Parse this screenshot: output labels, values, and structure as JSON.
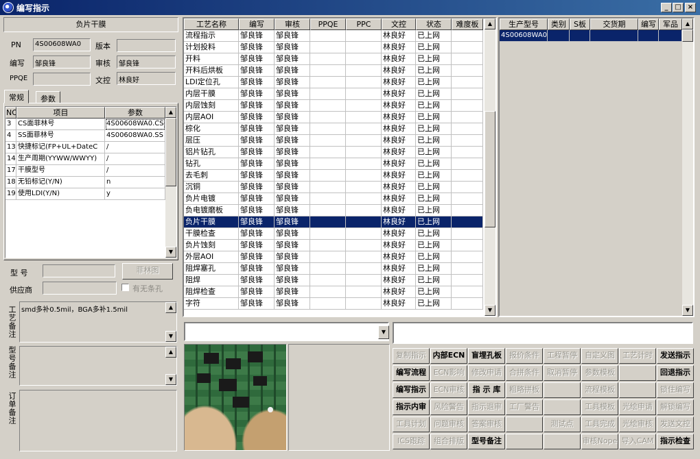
{
  "window": {
    "title": "编写指示",
    "min": "_",
    "max": "□",
    "close": "×"
  },
  "left": {
    "process_name": "负片干膜",
    "pn_label": "PN",
    "pn_value": "4S00608WA0",
    "version_label": "版本",
    "version_value": "",
    "writer_label": "编写",
    "writer_value": "邹良锋",
    "reviewer_label": "审核",
    "reviewer_value": "邹良锋",
    "ppqe_label": "PPQE",
    "ppqe_value": "",
    "doc_ctrl_label": "文控",
    "doc_ctrl_value": "林良好",
    "tabs": [
      "常规",
      "参数"
    ],
    "param_headers": [
      "NO",
      "项目",
      "参数"
    ],
    "params": [
      {
        "no": "3",
        "item": "CS面菲林号",
        "value": "4S00608WA0.CS"
      },
      {
        "no": "4",
        "item": "SS面菲林号",
        "value": "4S00608WA0.SS"
      },
      {
        "no": "13",
        "item": "快捷标记(FP+UL+DateC",
        "value": "/"
      },
      {
        "no": "14",
        "item": "生产周期(YYWW/WWYY)",
        "value": "/"
      },
      {
        "no": "17",
        "item": "干膜型号",
        "value": "/"
      },
      {
        "no": "18",
        "item": "无铅标记(Y/N)",
        "value": "n"
      },
      {
        "no": "19",
        "item": "使用LDI(Y/N)",
        "value": "y"
      }
    ],
    "model_label": "型  号",
    "model_value": "",
    "film_button": "菲林图",
    "supplier_label": "供应商",
    "supplier_value": "",
    "barcode_label": "有无条孔",
    "process_note_label": "工艺备注",
    "process_note": "smd多补0.5mil，BGA多补1.5mil",
    "model_note_label": "型号备注",
    "model_note": "",
    "order_note_label": "订单备注",
    "order_note": ""
  },
  "process_table": {
    "headers": [
      "工艺名称",
      "编写",
      "审核",
      "PPQE",
      "PPC",
      "文控",
      "状态",
      "难度板"
    ],
    "rows": [
      [
        "流程指示",
        "邹良锋",
        "邹良锋",
        "",
        "",
        "林良好",
        "已上网",
        ""
      ],
      [
        "计划投料",
        "邹良锋",
        "邹良锋",
        "",
        "",
        "林良好",
        "已上网",
        ""
      ],
      [
        "开料",
        "邹良锋",
        "邹良锋",
        "",
        "",
        "林良好",
        "已上网",
        ""
      ],
      [
        "开料后烘板",
        "邹良锋",
        "邹良锋",
        "",
        "",
        "林良好",
        "已上网",
        ""
      ],
      [
        "LDI定位孔",
        "邹良锋",
        "邹良锋",
        "",
        "",
        "林良好",
        "已上网",
        ""
      ],
      [
        "内层干膜",
        "邹良锋",
        "邹良锋",
        "",
        "",
        "林良好",
        "已上网",
        ""
      ],
      [
        "内层蚀刻",
        "邹良锋",
        "邹良锋",
        "",
        "",
        "林良好",
        "已上网",
        ""
      ],
      [
        "内层AOI",
        "邹良锋",
        "邹良锋",
        "",
        "",
        "林良好",
        "已上网",
        ""
      ],
      [
        "棕化",
        "邹良锋",
        "邹良锋",
        "",
        "",
        "林良好",
        "已上网",
        ""
      ],
      [
        "层压",
        "邹良锋",
        "邹良锋",
        "",
        "",
        "林良好",
        "已上网",
        ""
      ],
      [
        "铝片钻孔",
        "邹良锋",
        "邹良锋",
        "",
        "",
        "林良好",
        "已上网",
        ""
      ],
      [
        "钻孔",
        "邹良锋",
        "邹良锋",
        "",
        "",
        "林良好",
        "已上网",
        ""
      ],
      [
        "去毛刺",
        "邹良锋",
        "邹良锋",
        "",
        "",
        "林良好",
        "已上网",
        ""
      ],
      [
        "沉铜",
        "邹良锋",
        "邹良锋",
        "",
        "",
        "林良好",
        "已上网",
        ""
      ],
      [
        "负片电镀",
        "邹良锋",
        "邹良锋",
        "",
        "",
        "林良好",
        "已上网",
        ""
      ],
      [
        "负电镀磨板",
        "邹良锋",
        "邹良锋",
        "",
        "",
        "林良好",
        "已上网",
        ""
      ],
      [
        "负片干膜",
        "邹良锋",
        "邹良锋",
        "",
        "",
        "林良好",
        "已上网",
        ""
      ],
      [
        "干膜检查",
        "邹良锋",
        "邹良锋",
        "",
        "",
        "林良好",
        "已上网",
        ""
      ],
      [
        "负片蚀刻",
        "邹良锋",
        "邹良锋",
        "",
        "",
        "林良好",
        "已上网",
        ""
      ],
      [
        "外层AOI",
        "邹良锋",
        "邹良锋",
        "",
        "",
        "林良好",
        "已上网",
        ""
      ],
      [
        "阻焊塞孔",
        "邹良锋",
        "邹良锋",
        "",
        "",
        "林良好",
        "已上网",
        ""
      ],
      [
        "阻焊",
        "邹良锋",
        "邹良锋",
        "",
        "",
        "林良好",
        "已上网",
        ""
      ],
      [
        "阻焊检查",
        "邹良锋",
        "邹良锋",
        "",
        "",
        "林良好",
        "已上网",
        ""
      ],
      [
        "字符",
        "邹良锋",
        "邹良锋",
        "",
        "",
        "林良好",
        "已上网",
        ""
      ]
    ],
    "selected_index": 16
  },
  "product_table": {
    "headers": [
      "生产型号",
      "类别",
      "S板",
      "交货期",
      "编写",
      "军品"
    ],
    "rows": [
      [
        "4S00608WA0",
        "",
        "",
        "",
        "",
        ""
      ]
    ]
  },
  "buttons": [
    [
      {
        "t": "复制指示",
        "e": false
      },
      {
        "t": "内部ECN",
        "e": true
      },
      {
        "t": "盲埋孔板",
        "e": true
      },
      {
        "t": "报价条件",
        "e": false
      },
      {
        "t": "工程暂停",
        "e": false
      },
      {
        "t": "自定义图",
        "e": false
      },
      {
        "t": "工艺计时",
        "e": false
      },
      {
        "t": "发送指示",
        "e": true
      }
    ],
    [
      {
        "t": "编写流程",
        "e": true
      },
      {
        "t": "ECN影响",
        "e": false
      },
      {
        "t": "修改申请",
        "e": false
      },
      {
        "t": "合拼条件",
        "e": false
      },
      {
        "t": "取消暂停",
        "e": false
      },
      {
        "t": "参数模板",
        "e": false
      },
      {
        "t": "",
        "e": false
      },
      {
        "t": "回退指示",
        "e": true
      }
    ],
    [
      {
        "t": "编写指示",
        "e": true
      },
      {
        "t": "ECN审核",
        "e": false
      },
      {
        "t": "指 示 库",
        "e": true
      },
      {
        "t": "粗略拼板",
        "e": false
      },
      {
        "t": "",
        "e": false
      },
      {
        "t": "流程模板",
        "e": false
      },
      {
        "t": "",
        "e": false
      },
      {
        "t": "锁住编写",
        "e": false
      }
    ],
    [
      {
        "t": "指示内审",
        "e": true
      },
      {
        "t": "风险警告",
        "e": false
      },
      {
        "t": "指示退审",
        "e": false
      },
      {
        "t": "工厂警告",
        "e": false
      },
      {
        "t": "",
        "e": false
      },
      {
        "t": "工具模板",
        "e": false
      },
      {
        "t": "光绘申请",
        "e": false
      },
      {
        "t": "解锁编写",
        "e": false
      }
    ],
    [
      {
        "t": "工具计划",
        "e": false
      },
      {
        "t": "问题审核",
        "e": false
      },
      {
        "t": "答案审核",
        "e": false
      },
      {
        "t": "",
        "e": false
      },
      {
        "t": "测试点",
        "e": false
      },
      {
        "t": "工具完成",
        "e": false
      },
      {
        "t": "光绘审核",
        "e": false
      },
      {
        "t": "发送文控",
        "e": false
      }
    ],
    [
      {
        "t": "ICS跟踪",
        "e": false
      },
      {
        "t": "组合排版",
        "e": false
      },
      {
        "t": "型号备注",
        "e": true
      },
      {
        "t": "",
        "e": false
      },
      {
        "t": "",
        "e": false
      },
      {
        "t": "审核Nope",
        "e": false
      },
      {
        "t": "导入CAM",
        "e": false
      },
      {
        "t": "指示检查",
        "e": true
      }
    ]
  ],
  "colors": {
    "titlebar": "#0a246a",
    "selection": "#0a246a",
    "face": "#d4d0c8"
  }
}
